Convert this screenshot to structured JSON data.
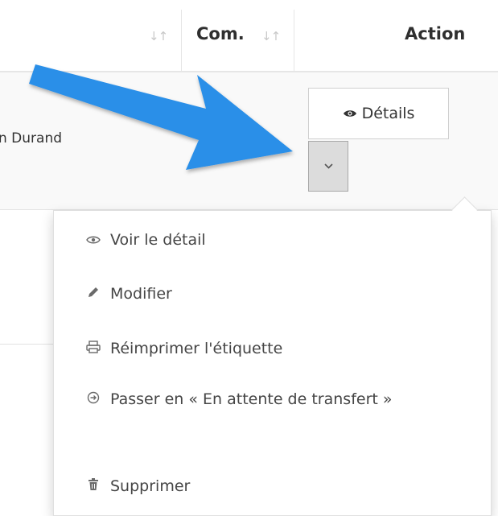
{
  "table": {
    "columns": [
      {
        "label": "",
        "sortable": true
      },
      {
        "label": "Com.",
        "sortable": true
      },
      {
        "label": "Action",
        "sortable": false
      }
    ],
    "sort_icon": "↓↑",
    "rows": [
      {
        "name": "n Durand"
      }
    ]
  },
  "actions": {
    "details_icon": "eye-icon",
    "details_label": "Détails",
    "toggle_icon": "chevron-down-icon"
  },
  "menu": {
    "items": [
      {
        "label": "Voir le détail",
        "icon": "eye-icon"
      },
      {
        "label": "Modifier",
        "icon": "pencil-icon"
      },
      {
        "label": "Réimprimer l'étiquette",
        "icon": "print-icon"
      },
      {
        "label": "Passer en « En attente de transfert »",
        "icon": "arrow-circle-icon"
      },
      {
        "label": "Supprimer",
        "icon": "trash-icon"
      }
    ]
  },
  "colors": {
    "arrow": "#2a8fe8",
    "row_alt": "#f9f9f9",
    "toggle_bg": "#dcdcdc"
  }
}
